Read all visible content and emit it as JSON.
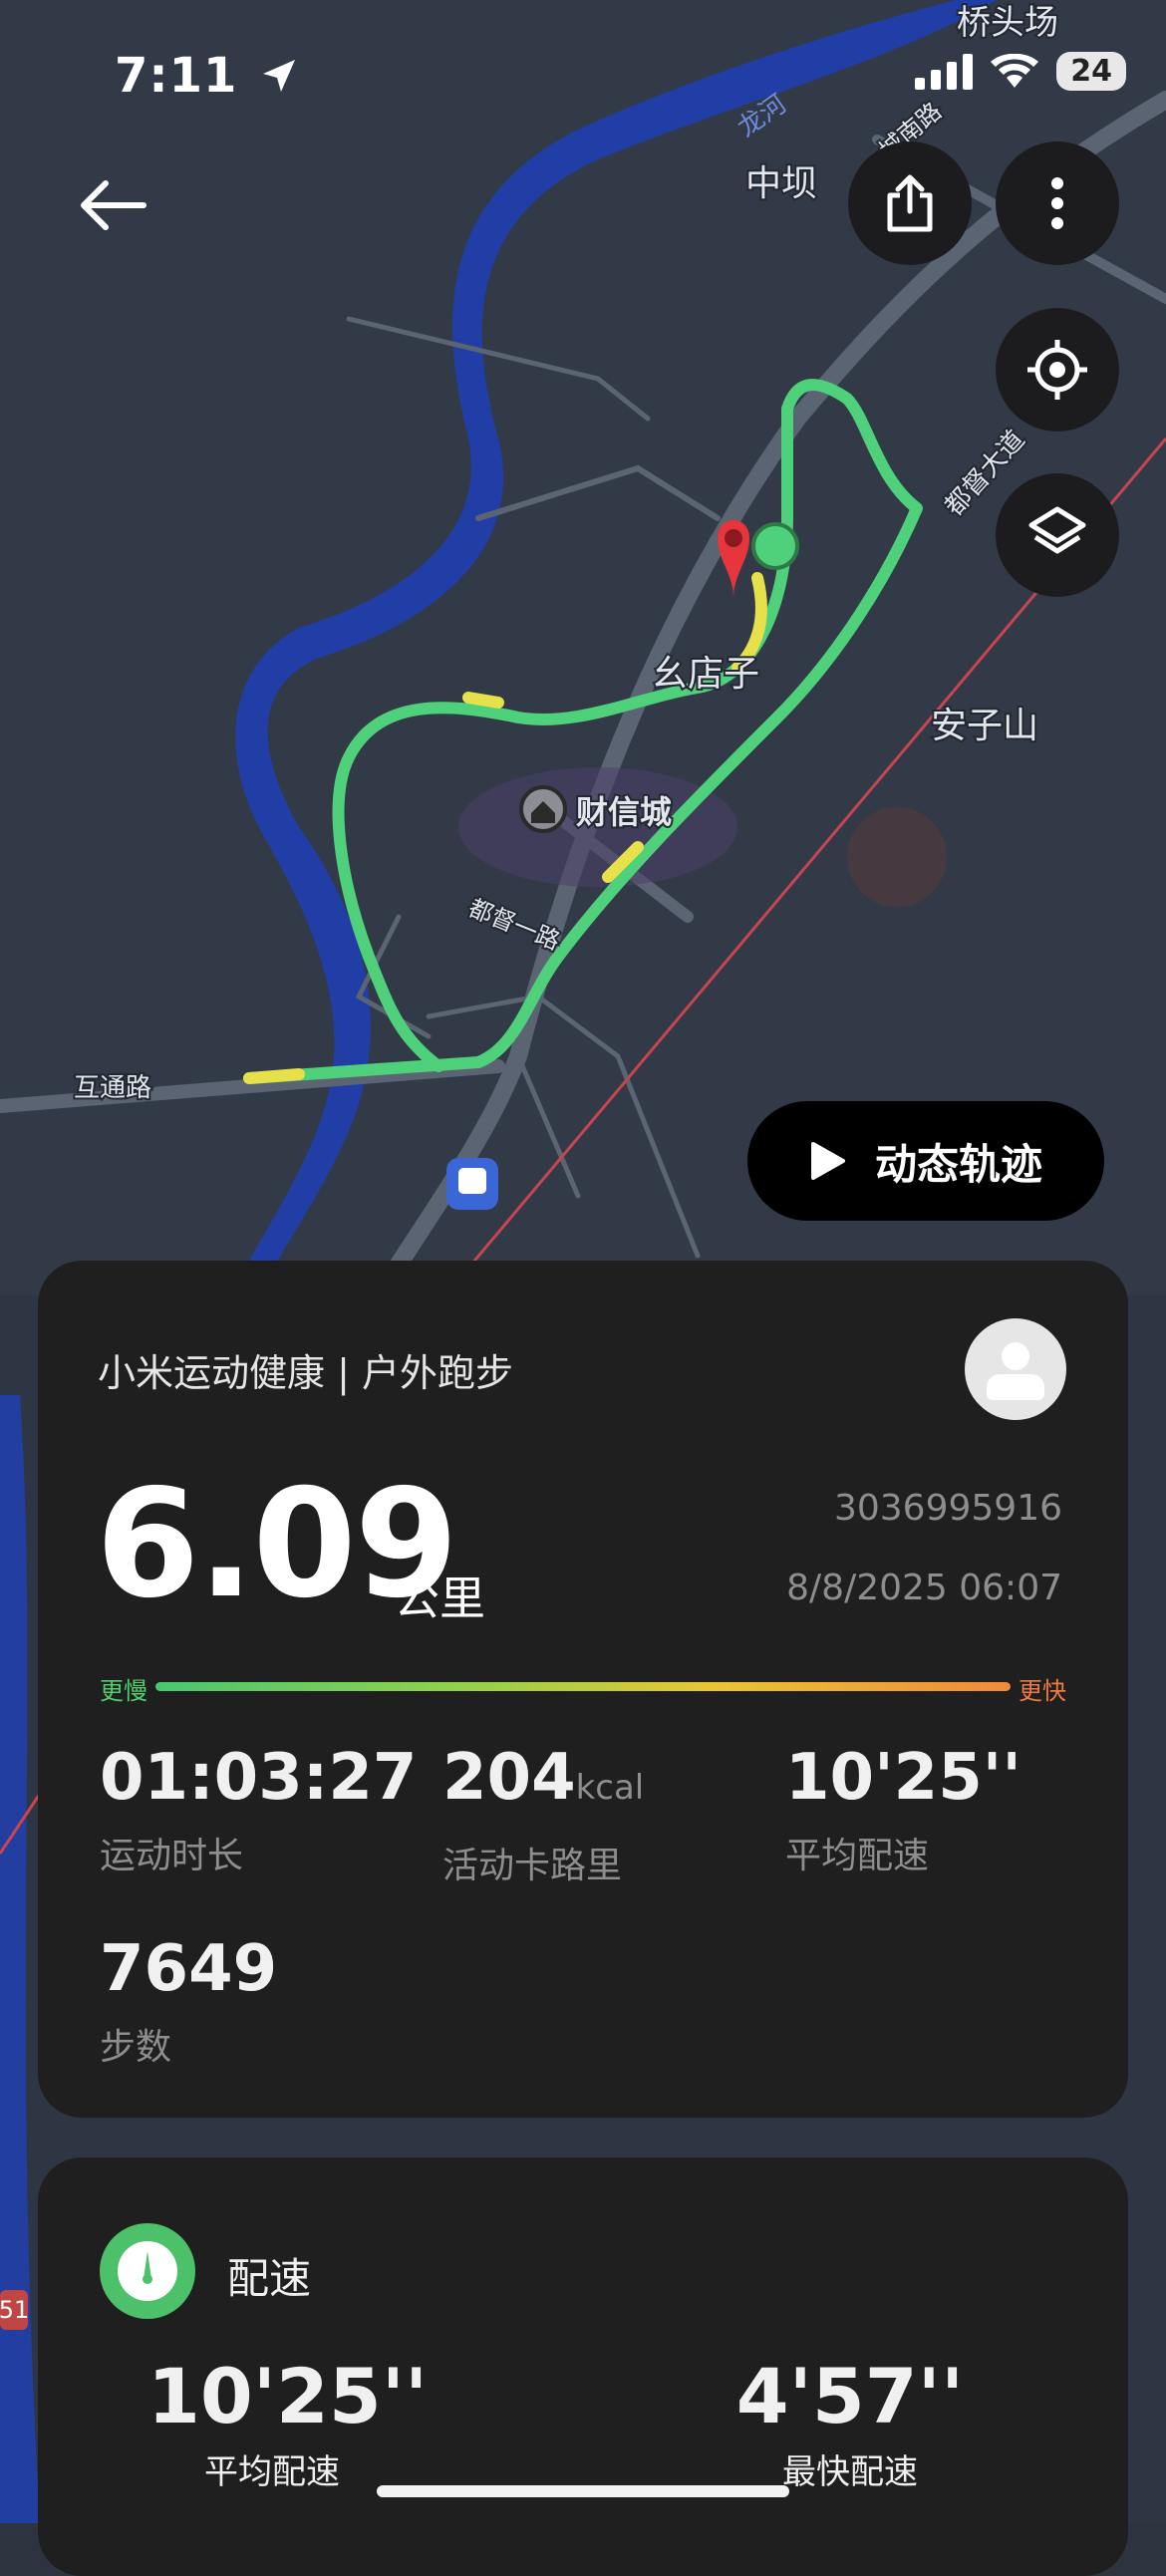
{
  "status_bar": {
    "time": "7:11",
    "battery": "24"
  },
  "map": {
    "labels": {
      "qiaotouchang": "桥头场",
      "longhe": "龙河",
      "chengnan_rd": "城南路",
      "zhongba": "中坝",
      "dudu_ave": "都督大道",
      "yaodianzi": "幺店子",
      "anzishan": "安子山",
      "caixincheng": "财信城",
      "dudu_1rd": "都督一路",
      "hutong_rd": "互通路",
      "road_badge": "51"
    }
  },
  "actions": {
    "dynamic_track": "动态轨迹"
  },
  "summary": {
    "title": "小米运动健康 | 户外跑步",
    "distance": "6.09",
    "distance_unit": "公里",
    "record_id": "3036995916",
    "datetime": "8/8/2025 06:07",
    "pace_scale": {
      "slow": "更慢",
      "fast": "更快"
    },
    "stats": [
      {
        "value": "01:03:27",
        "unit": "",
        "label": "运动时长"
      },
      {
        "value": "204",
        "unit": "kcal",
        "label": "活动卡路里"
      },
      {
        "value": "10'25''",
        "unit": "",
        "label": "平均配速"
      },
      {
        "value": "7649",
        "unit": "",
        "label": "步数"
      }
    ]
  },
  "pace_card": {
    "title": "配速",
    "avg_value": "10'25''",
    "avg_label": "平均配速",
    "fast_value": "4'57''",
    "fast_label": "最快配速"
  },
  "colors": {
    "track_green": "#4fd07a",
    "track_yellow": "#e6e04a",
    "river_blue": "#1f3fb0",
    "card_bg": "#1f1f20",
    "accent_green": "#4cc16a",
    "pin_red": "#e8343c"
  }
}
